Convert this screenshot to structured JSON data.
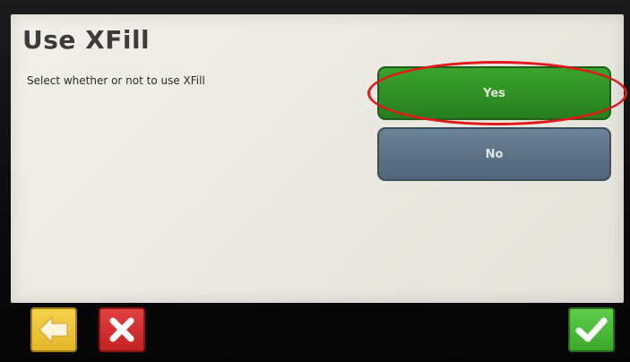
{
  "screen": {
    "title": "Use XFill",
    "instruction": "Select whether or not to use XFill"
  },
  "options": {
    "yes_label": "Yes",
    "no_label": "No",
    "selected": "Yes"
  },
  "nav": {
    "back_icon": "arrow-left-icon",
    "cancel_icon": "close-icon",
    "confirm_icon": "checkmark-icon"
  },
  "colors": {
    "yes_button": "#2e8f24",
    "no_button": "#5b6f82",
    "highlight_circle": "#e01818",
    "back_button": "#f0c43a",
    "cancel_button": "#d32f2f",
    "confirm_button": "#4cbf3a"
  }
}
